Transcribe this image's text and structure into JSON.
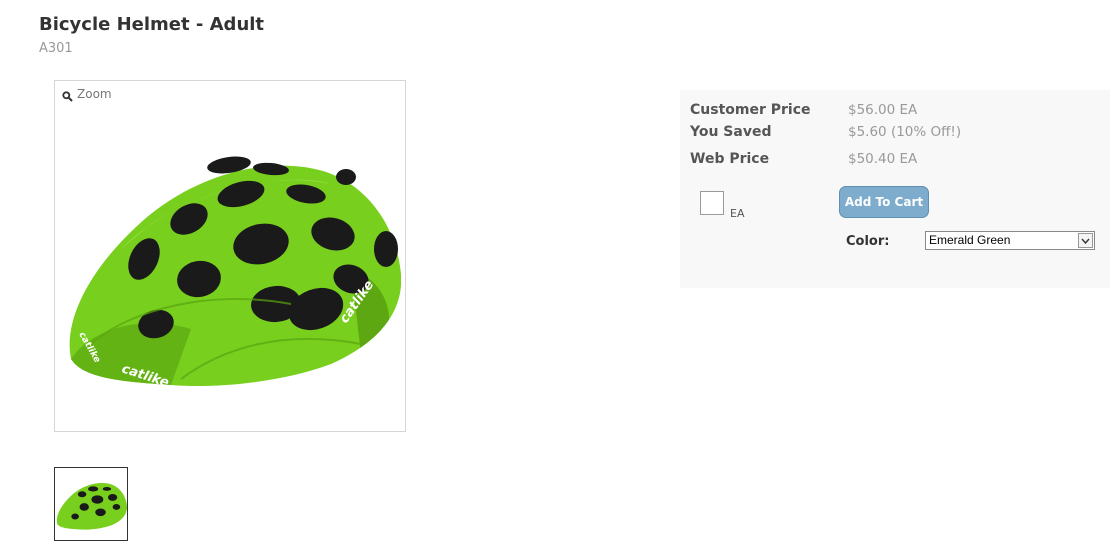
{
  "product": {
    "title": "Bicycle Helmet - Adult",
    "sku": "A301"
  },
  "gallery": {
    "zoom_label": "Zoom",
    "main_image_icon": "helmet-image",
    "brand_text": "catlike"
  },
  "pricing": {
    "customer_price_label": "Customer Price",
    "customer_price_value": "$56.00 EA",
    "you_saved_label": "You Saved",
    "you_saved_value": "$5.60 (10% Off!)",
    "web_price_label": "Web Price",
    "web_price_value": "$50.40 EA"
  },
  "purchase": {
    "quantity_value": "",
    "uom_label": "EA",
    "add_to_cart_label": "Add To Cart",
    "color_label": "Color:",
    "color_selected": "Emerald Green"
  },
  "colors": {
    "helmet_green": "#7ed321",
    "button_blue": "#7eaccd",
    "panel_bg": "#f8f8f8"
  }
}
